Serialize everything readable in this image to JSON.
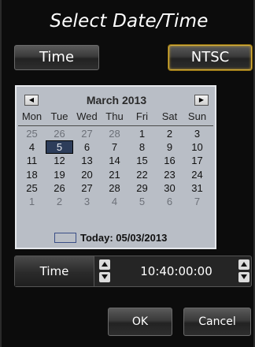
{
  "dialog": {
    "title": "Select Date/Time",
    "time_button": "Time",
    "standard_button": "NTSC"
  },
  "calendar": {
    "prev_icon": "arrow-left-icon",
    "next_icon": "arrow-right-icon",
    "month_label": "March 2013",
    "weekdays": [
      "Mon",
      "Tue",
      "Wed",
      "Thu",
      "Fri",
      "Sat",
      "Sun"
    ],
    "weeks": [
      [
        "25",
        "26",
        "27",
        "28",
        "1",
        "2",
        "3"
      ],
      [
        "4",
        "5",
        "6",
        "7",
        "8",
        "9",
        "10"
      ],
      [
        "11",
        "12",
        "13",
        "14",
        "15",
        "16",
        "17"
      ],
      [
        "18",
        "19",
        "20",
        "21",
        "22",
        "23",
        "24"
      ],
      [
        "25",
        "26",
        "27",
        "28",
        "29",
        "30",
        "31"
      ],
      [
        "1",
        "2",
        "3",
        "4",
        "5",
        "6",
        "7"
      ]
    ],
    "selected_day": "5",
    "today_text": "Today: 05/03/2013"
  },
  "time_row": {
    "label": "Time",
    "value": "10:40:00:00"
  },
  "actions": {
    "ok": "OK",
    "cancel": "Cancel"
  },
  "colors": {
    "background": "#0c0c0c",
    "calendar_bg": "#b9bec6",
    "selected_day_bg": "#2d3d5a",
    "active_accent": "#d9b23a"
  }
}
